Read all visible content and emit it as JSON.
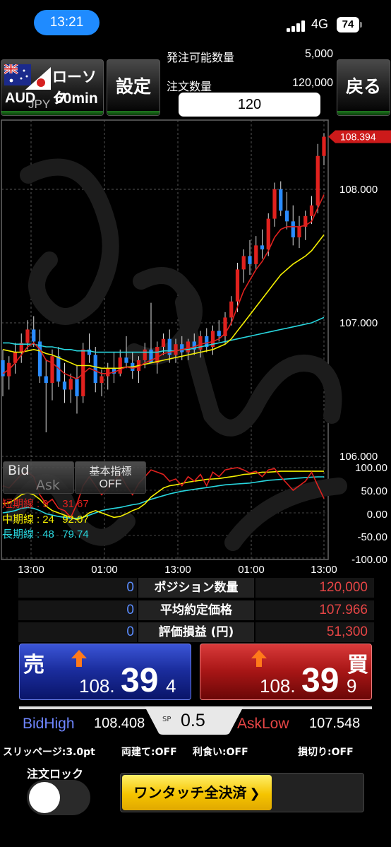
{
  "status": {
    "time": "13:21",
    "network": "4G",
    "battery": "74"
  },
  "toolbar": {
    "chart_type": "ローソク",
    "pair_base": "AUD",
    "pair_quote": "JPY",
    "timeframe": "60min",
    "settings_label": "設定",
    "back_label": "戻る"
  },
  "order": {
    "available_label": "発注可能数量",
    "available_value": "5,000",
    "qty_label": "注文数量",
    "qty_value": "120,000",
    "qty_input": "120"
  },
  "chart_data": {
    "type": "candlestick",
    "pair": "AUD/JPY",
    "timeframe": "60min",
    "current_price": "108.394",
    "y_ticks": [
      "108.000",
      "107.000",
      "106.000"
    ],
    "ylim": [
      106.0,
      108.5
    ],
    "x_ticks": [
      "13:00",
      "01:00",
      "13:00",
      "01:00",
      "13:00"
    ],
    "candles": [
      [
        106.72,
        106.8,
        106.45,
        106.6
      ],
      [
        106.6,
        106.75,
        106.5,
        106.7
      ],
      [
        106.7,
        106.85,
        106.62,
        106.78
      ],
      [
        106.78,
        106.92,
        106.7,
        106.85
      ],
      [
        106.85,
        107.02,
        106.8,
        106.95
      ],
      [
        106.95,
        107.05,
        106.82,
        106.86
      ],
      [
        106.86,
        106.95,
        106.55,
        106.6
      ],
      [
        106.6,
        106.72,
        106.18,
        106.55
      ],
      [
        106.55,
        106.8,
        106.42,
        106.75
      ],
      [
        106.75,
        106.82,
        106.52,
        106.56
      ],
      [
        106.56,
        106.7,
        106.4,
        106.5
      ],
      [
        106.5,
        106.62,
        106.4,
        106.58
      ],
      [
        106.58,
        106.68,
        106.32,
        106.45
      ],
      [
        106.45,
        106.85,
        106.4,
        106.8
      ],
      [
        106.8,
        106.92,
        106.7,
        106.76
      ],
      [
        106.76,
        106.82,
        106.48,
        106.55
      ],
      [
        106.55,
        106.65,
        106.45,
        106.6
      ],
      [
        106.6,
        106.7,
        106.5,
        106.66
      ],
      [
        106.66,
        106.78,
        106.55,
        106.62
      ],
      [
        106.62,
        106.8,
        106.6,
        106.74
      ],
      [
        106.74,
        106.9,
        106.66,
        106.7
      ],
      [
        106.7,
        106.78,
        106.58,
        106.64
      ],
      [
        106.64,
        106.75,
        106.55,
        106.72
      ],
      [
        106.72,
        106.85,
        106.66,
        106.8
      ],
      [
        106.8,
        107.15,
        106.74,
        106.7
      ],
      [
        106.7,
        106.86,
        106.62,
        106.82
      ],
      [
        106.82,
        106.92,
        106.76,
        106.88
      ],
      [
        106.88,
        106.95,
        106.7,
        106.76
      ],
      [
        106.76,
        106.88,
        106.7,
        106.84
      ],
      [
        106.84,
        106.9,
        106.72,
        106.78
      ],
      [
        106.78,
        106.88,
        106.72,
        106.86
      ],
      [
        106.86,
        106.92,
        106.76,
        106.8
      ],
      [
        106.8,
        106.94,
        106.74,
        106.9
      ],
      [
        106.9,
        106.96,
        106.78,
        106.82
      ],
      [
        106.82,
        106.98,
        106.76,
        106.94
      ],
      [
        106.94,
        107.02,
        106.86,
        106.9
      ],
      [
        106.9,
        107.08,
        106.84,
        107.04
      ],
      [
        107.04,
        107.2,
        106.98,
        107.16
      ],
      [
        107.16,
        107.45,
        107.08,
        107.4
      ],
      [
        107.4,
        107.55,
        107.3,
        107.5
      ],
      [
        107.5,
        107.62,
        107.36,
        107.44
      ],
      [
        107.44,
        107.65,
        107.4,
        107.58
      ],
      [
        107.58,
        107.7,
        107.48,
        107.55
      ],
      [
        107.55,
        107.82,
        107.5,
        107.78
      ],
      [
        107.78,
        108.05,
        107.72,
        108.0
      ],
      [
        108.0,
        108.06,
        107.8,
        107.84
      ],
      [
        107.84,
        107.98,
        107.7,
        107.76
      ],
      [
        107.76,
        107.88,
        107.58,
        107.64
      ],
      [
        107.64,
        107.8,
        107.56,
        107.72
      ],
      [
        107.72,
        107.84,
        107.62,
        107.8
      ],
      [
        107.8,
        107.95,
        107.74,
        107.88
      ],
      [
        107.88,
        108.34,
        107.82,
        108.25
      ],
      [
        108.25,
        108.42,
        108.18,
        108.394
      ]
    ],
    "ma_short": [
      106.62,
      106.65,
      106.7,
      106.76,
      106.82,
      106.85,
      106.8,
      106.72,
      106.7,
      106.66,
      106.62,
      106.6,
      106.58,
      106.62,
      106.66,
      106.64,
      106.62,
      106.62,
      106.63,
      106.65,
      106.67,
      106.66,
      106.67,
      106.7,
      106.72,
      106.74,
      106.77,
      106.78,
      106.79,
      106.8,
      106.81,
      106.82,
      106.84,
      106.85,
      106.86,
      106.88,
      106.92,
      107.0,
      107.12,
      107.24,
      107.32,
      107.4,
      107.46,
      107.54,
      107.64,
      107.7,
      107.72,
      107.72,
      107.72,
      107.73,
      107.76,
      107.86,
      107.96
    ],
    "ma_mid": [
      106.8,
      106.79,
      106.78,
      106.78,
      106.79,
      106.8,
      106.79,
      106.77,
      106.76,
      106.74,
      106.72,
      106.7,
      106.68,
      106.68,
      106.68,
      106.67,
      106.66,
      106.66,
      106.66,
      106.66,
      106.67,
      106.67,
      106.68,
      106.69,
      106.7,
      106.71,
      106.72,
      106.73,
      106.74,
      106.75,
      106.76,
      106.77,
      106.78,
      106.79,
      106.8,
      106.82,
      106.84,
      106.88,
      106.94,
      107.0,
      107.06,
      107.12,
      107.18,
      107.24,
      107.3,
      107.36,
      107.4,
      107.44,
      107.47,
      107.5,
      107.54,
      107.6,
      107.66
    ],
    "ma_long": [
      106.85,
      106.85,
      106.84,
      106.84,
      106.84,
      106.84,
      106.83,
      106.82,
      106.82,
      106.81,
      106.8,
      106.8,
      106.79,
      106.79,
      106.79,
      106.78,
      106.78,
      106.78,
      106.78,
      106.78,
      106.78,
      106.78,
      106.78,
      106.78,
      106.78,
      106.78,
      106.79,
      106.79,
      106.79,
      106.8,
      106.8,
      106.81,
      106.82,
      106.83,
      106.84,
      106.85,
      106.86,
      106.87,
      106.88,
      106.89,
      106.9,
      106.91,
      106.92,
      106.93,
      106.94,
      106.95,
      106.96,
      106.97,
      106.98,
      106.99,
      107.0,
      107.02,
      107.04
    ],
    "oscillator": {
      "y_ticks": [
        "100.00",
        "50.00",
        "0.00",
        "-50.00",
        "-100.00"
      ],
      "short_line": [
        60,
        55,
        70,
        85,
        90,
        80,
        40,
        20,
        30,
        10,
        5,
        -10,
        20,
        60,
        80,
        60,
        40,
        55,
        70,
        85,
        60,
        40,
        65,
        80,
        95,
        90,
        85,
        70,
        75,
        60,
        80,
        70,
        85,
        60,
        90,
        80,
        95,
        98,
        100,
        95,
        88,
        92,
        80,
        95,
        98,
        80,
        65,
        50,
        60,
        70,
        90,
        60,
        31.67
      ],
      "mid_line": [
        20,
        22,
        30,
        40,
        45,
        40,
        30,
        15,
        5,
        0,
        -5,
        -10,
        -15,
        -10,
        0,
        5,
        0,
        -5,
        -10,
        -8,
        -2,
        5,
        10,
        20,
        35,
        45,
        55,
        60,
        62,
        65,
        68,
        70,
        72,
        74,
        75,
        76,
        78,
        80,
        82,
        85,
        86,
        88,
        90,
        90,
        91,
        92,
        92,
        92,
        92,
        92,
        92,
        92,
        92.07
      ],
      "long_line": [
        0,
        2,
        5,
        10,
        12,
        10,
        5,
        -2,
        -5,
        -8,
        -10,
        -12,
        -12,
        -10,
        -5,
        0,
        5,
        8,
        10,
        12,
        15,
        18,
        20,
        25,
        30,
        34,
        38,
        42,
        45,
        48,
        50,
        52,
        54,
        56,
        58,
        60,
        62,
        63,
        64,
        65,
        66,
        68,
        70,
        72,
        73,
        74,
        75,
        76,
        77,
        78,
        79,
        79.5,
        79.74
      ]
    },
    "gridlines": true
  },
  "chart_ui": {
    "bid_label": "Bid",
    "ask_label": "Ask",
    "indicator_label": "基本指標",
    "indicator_state": "OFF",
    "legend": [
      {
        "name": "短期線",
        "period": "9",
        "value": "31.67",
        "color": "#e0211e"
      },
      {
        "name": "中期線",
        "period": "24",
        "value": "92.07",
        "color": "#f5f000"
      },
      {
        "name": "長期線",
        "period": "48",
        "value": "79.74",
        "color": "#28d6de"
      }
    ]
  },
  "positions": {
    "rows": [
      {
        "count": "0",
        "label": "ポジション数量",
        "value": "120,000"
      },
      {
        "count": "0",
        "label": "平均約定価格",
        "value": "107.966"
      },
      {
        "count": "0",
        "label": "評価損益 (円)",
        "value": "51,300"
      }
    ]
  },
  "sell": {
    "label": "売",
    "price_main": "108.",
    "price_big": "39",
    "price_last": "4"
  },
  "buy": {
    "label": "買",
    "price_main": "108.",
    "price_big": "39",
    "price_last": "9"
  },
  "spread": {
    "sp_label": "SP",
    "value": "0.5"
  },
  "highlow": {
    "bid_high_label": "BidHigh",
    "bid_high_value": "108.408",
    "ask_low_label": "AskLow",
    "ask_low_value": "107.548"
  },
  "options": {
    "slippage": "スリッページ:3.0pt",
    "hedge": "両建て:OFF",
    "take_profit": "利食い:OFF",
    "stop_loss": "損切り:OFF"
  },
  "order_lock": {
    "label": "注文ロック"
  },
  "close_all": {
    "label": "ワンタッチ全決済"
  },
  "colors": {
    "up": "#e0211e",
    "down": "#2a8cff",
    "accent_blue": "#1f8bff"
  }
}
